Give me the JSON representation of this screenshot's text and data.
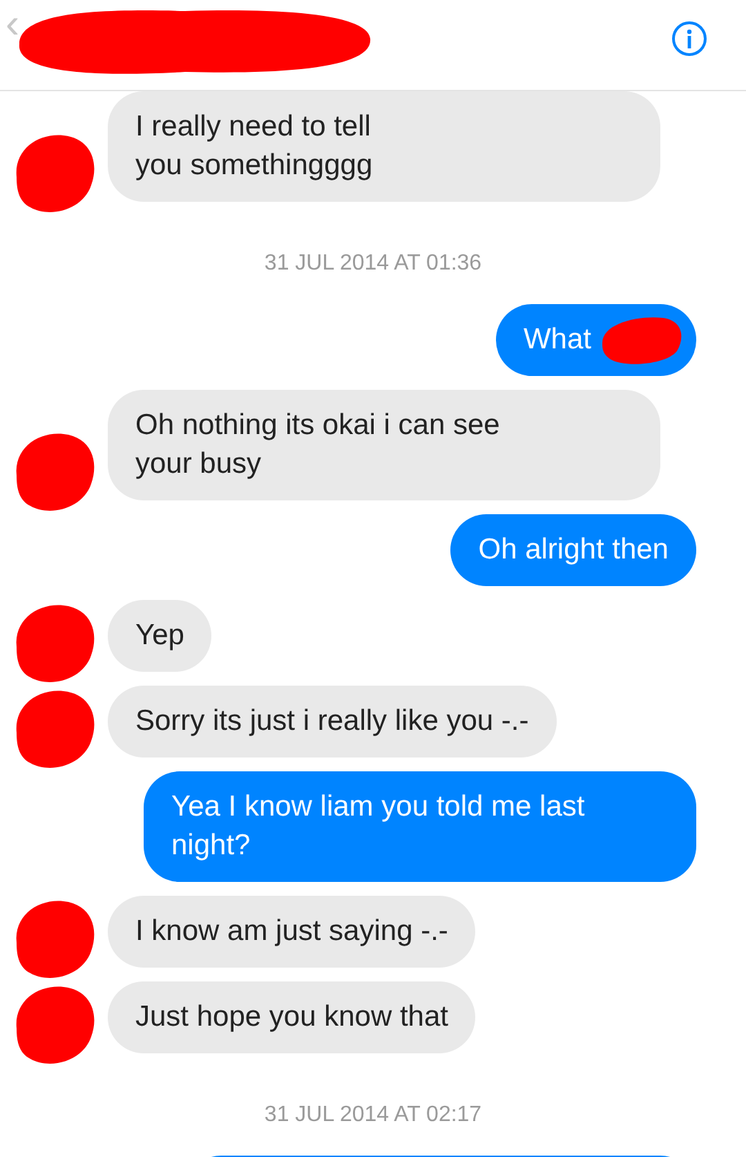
{
  "header": {
    "back": "‹"
  },
  "messages": [
    {
      "kind": "in",
      "text": "I really need to tell\nyou somethingggg"
    },
    {
      "kind": "time",
      "text": "31 JUL 2014 AT 01:36"
    },
    {
      "kind": "out",
      "text": "What",
      "redacted": true
    },
    {
      "kind": "in",
      "text": "Oh nothing its okai i can see\nyour busy"
    },
    {
      "kind": "out",
      "text": "Oh alright then"
    },
    {
      "kind": "in",
      "text": "Yep"
    },
    {
      "kind": "in",
      "text": "Sorry its just i really like you -.-"
    },
    {
      "kind": "out",
      "text": "Yea I know liam you told me last\nnight?"
    },
    {
      "kind": "in",
      "text": "I know am just saying -.-"
    },
    {
      "kind": "in",
      "text": "Just hope you know that"
    },
    {
      "kind": "time",
      "text": "31 JUL 2014 AT 02:17"
    },
    {
      "kind": "out"
    }
  ]
}
